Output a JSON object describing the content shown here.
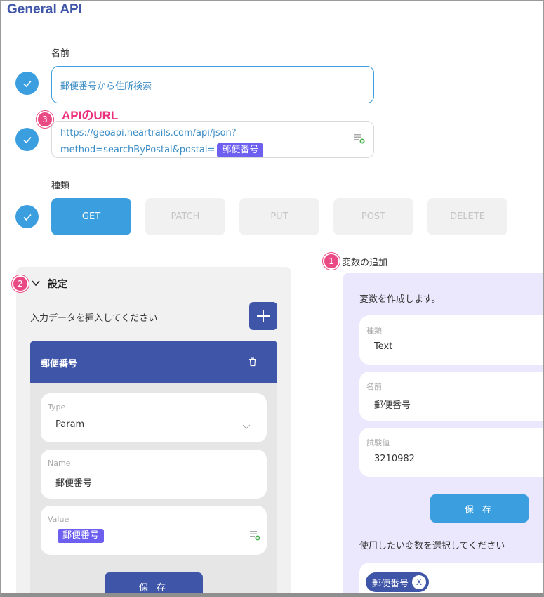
{
  "page": {
    "title": "General API"
  },
  "name_section": {
    "label": "名前",
    "value": "郵便番号から住所検索"
  },
  "url_section": {
    "annotation_badge": "3",
    "annotation_text": "APIのURL",
    "line1": "https://geoapi.heartrails.com/api/json?",
    "line2_prefix": "method=searchByPostal&postal=",
    "variable_chip": "郵便番号"
  },
  "type_section": {
    "label": "種類",
    "methods": [
      "GET",
      "PATCH",
      "PUT",
      "POST",
      "DELETE"
    ],
    "selected": "GET"
  },
  "settings": {
    "badge": "2",
    "title": "設定",
    "insert_prompt": "入力データを挿入してください",
    "item": {
      "header": "郵便番号",
      "type_label": "Type",
      "type_value": "Param",
      "name_label": "Name",
      "name_value": "郵便番号",
      "value_label": "Value",
      "value_chip": "郵便番号",
      "save_label": "保 存"
    }
  },
  "variables": {
    "badge": "1",
    "title": "変数の追加",
    "intro": "変数を作成します。",
    "type_label": "種類",
    "type_value": "Text",
    "name_label": "名前",
    "name_value": "郵便番号",
    "test_label": "試験値",
    "test_value": "3210982",
    "save_label": "保 存",
    "select_prompt": "使用したい変数を選択してください",
    "selected_chip": "郵便番号",
    "chip_remove": "X"
  },
  "colors": {
    "accent_blue": "#3b9fdf",
    "indigo": "#3f55a8",
    "chip_purple": "#6d5ff0",
    "annotation_pink": "#ea4a83",
    "variables_bg": "#ebe7fd"
  },
  "icons": [
    "check-icon",
    "list-add-icon",
    "chevron-down-icon",
    "plus-icon",
    "trash-icon",
    "chevron-select-icon"
  ]
}
